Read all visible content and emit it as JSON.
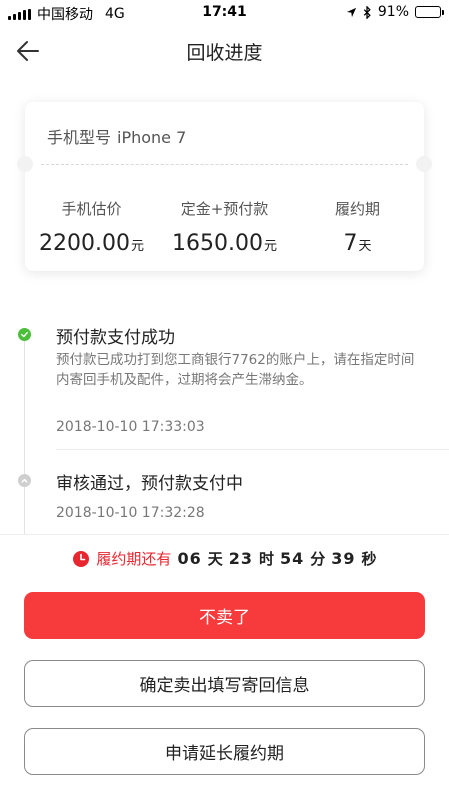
{
  "status_bar": {
    "carrier": "中国移动",
    "network": "4G",
    "time": "17:41",
    "battery": "91%",
    "battery_level": 0.91
  },
  "header": {
    "title": "回收进度"
  },
  "card": {
    "model_label": "手机型号",
    "model_value": "iPhone 7",
    "stats": [
      {
        "label": "手机估价",
        "value": "2200.00",
        "unit": "元"
      },
      {
        "label": "定金+预付款",
        "value": "1650.00",
        "unit": "元"
      },
      {
        "label": "履约期",
        "value": "7",
        "unit": "天"
      }
    ]
  },
  "timeline": {
    "items": [
      {
        "title": "预付款支付成功",
        "desc": "预付款已成功打到您工商银行7762的账户上，请在指定时间内寄回手机及配件，过期将会产生滞纳金。",
        "time": "2018-10-10 17:33:03"
      },
      {
        "title": "审核通过，预付款支付中",
        "time": "2018-10-10 17:32:28"
      }
    ]
  },
  "countdown": {
    "label": "履约期还有",
    "days": "06",
    "days_unit": "天",
    "hours": "23",
    "hours_unit": "时",
    "minutes": "54",
    "minutes_unit": "分",
    "seconds": "39",
    "seconds_unit": "秒"
  },
  "buttons": {
    "cancel_sale": "不卖了",
    "confirm_sale": "确定卖出填写寄回信息",
    "extend_period": "申请延长履约期"
  },
  "colors": {
    "accent": "#f73b3d",
    "success": "#4bbf3a"
  }
}
